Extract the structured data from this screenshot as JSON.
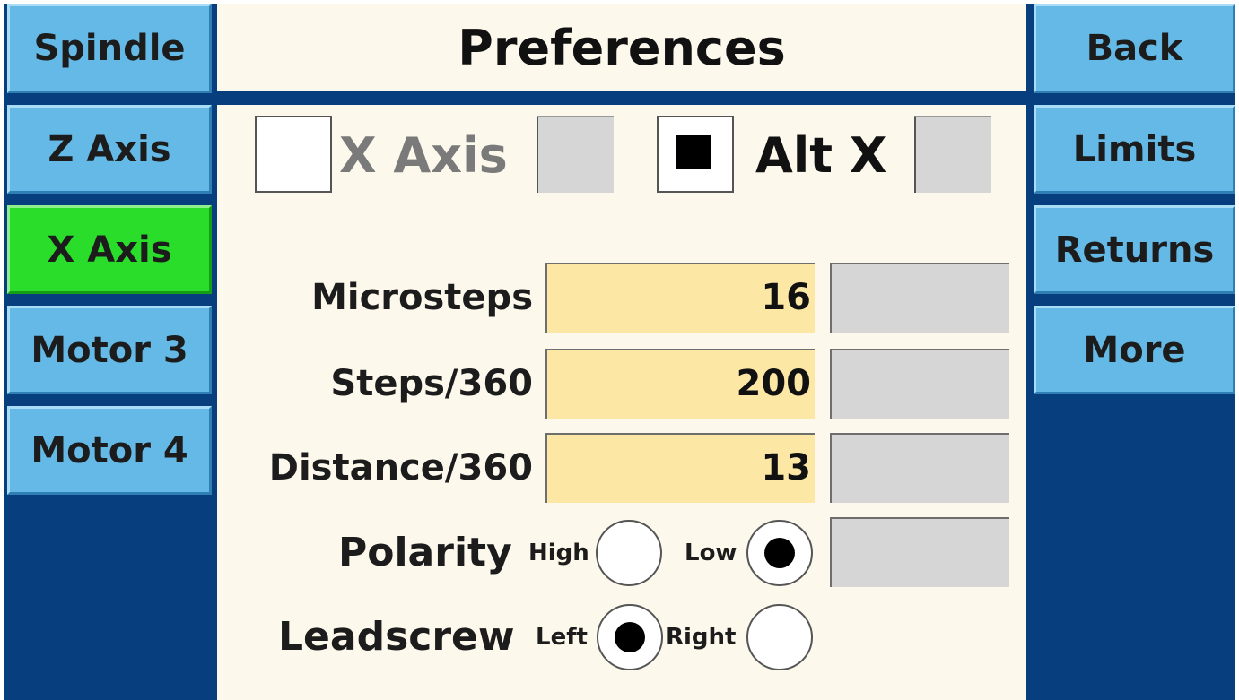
{
  "header": {
    "title": "Preferences"
  },
  "left_nav": [
    {
      "label": "Spindle",
      "active": false
    },
    {
      "label": "Z Axis",
      "active": false
    },
    {
      "label": "X Axis",
      "active": true
    },
    {
      "label": "Motor 3",
      "active": false
    },
    {
      "label": "Motor 4",
      "active": false
    }
  ],
  "right_nav": [
    {
      "label": "Back"
    },
    {
      "label": "Limits"
    },
    {
      "label": "Returns"
    },
    {
      "label": "More"
    }
  ],
  "axis_select": {
    "x_axis": {
      "label": "X Axis",
      "checked": false
    },
    "alt_x": {
      "label": "Alt X",
      "checked": true
    }
  },
  "fields": {
    "microsteps": {
      "label": "Microsteps",
      "value": "16"
    },
    "steps": {
      "label": "Steps/360",
      "value": "200"
    },
    "distance": {
      "label": "Distance/360",
      "value": "13"
    }
  },
  "polarity": {
    "label": "Polarity",
    "high_label": "High",
    "low_label": "Low",
    "selected": "Low"
  },
  "leadscrew": {
    "label": "Leadscrew",
    "left_label": "Left",
    "right_label": "Right",
    "selected": "Left"
  },
  "colors": {
    "background": "#073f7e",
    "button": "#64b9e6",
    "active_button": "#2bdd2b",
    "panel": "#fcf8ec",
    "input_field": "#fce7a5",
    "disabled_field": "#d6d6d6"
  }
}
